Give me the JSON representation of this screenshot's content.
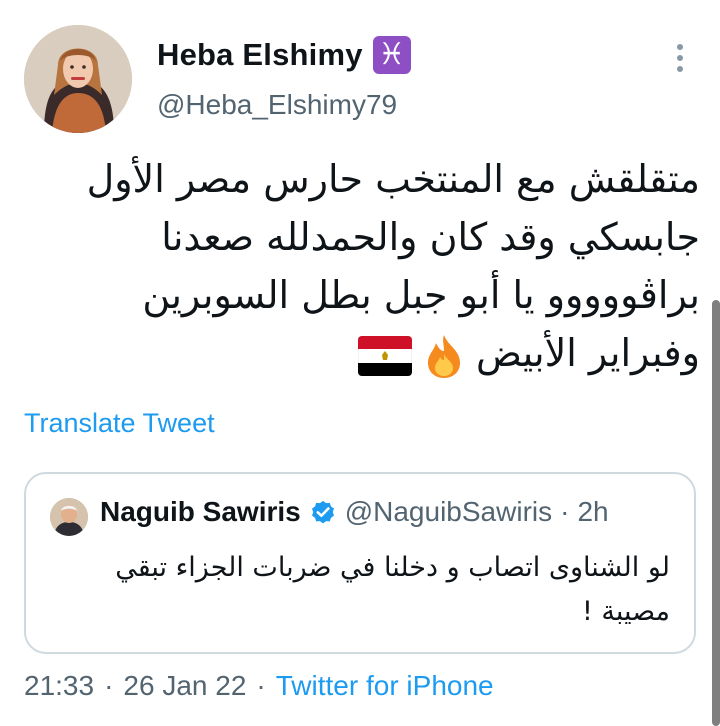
{
  "author": {
    "display_name": "Heba Elshimy",
    "zodiac_badge": "♓",
    "handle": "@Heba_Elshimy79",
    "avatar_icon": "profile-photo"
  },
  "tweet": {
    "lines": [
      "متقلقش مع المنتخب حارس مصر الأول",
      "جابسكي وقد كان والحمدلله صعدنا",
      "براڤووووو يا أبو جبل بطل السوبرين",
      "وفبراير الأبيض"
    ],
    "emojis": [
      "fire-emoji",
      "egypt-flag-emoji"
    ]
  },
  "translate_label": "Translate Tweet",
  "quoted_tweet": {
    "name": "Naguib Sawiris",
    "handle": "@NaguibSawiris",
    "separator": "·",
    "time": "2h",
    "lines": [
      "لو الشناوى اتصاب و دخلنا في ضربات الجزاء تبقي",
      "مصيبة !"
    ]
  },
  "meta": {
    "time": "21:33",
    "dot": "·",
    "date": "26 Jan 22",
    "source": "Twitter for iPhone"
  },
  "colors": {
    "accent": "#1d9bf0",
    "secondary_text": "#536471",
    "border": "#cfd9de",
    "zodiac_bg": "#8e4fc4"
  }
}
